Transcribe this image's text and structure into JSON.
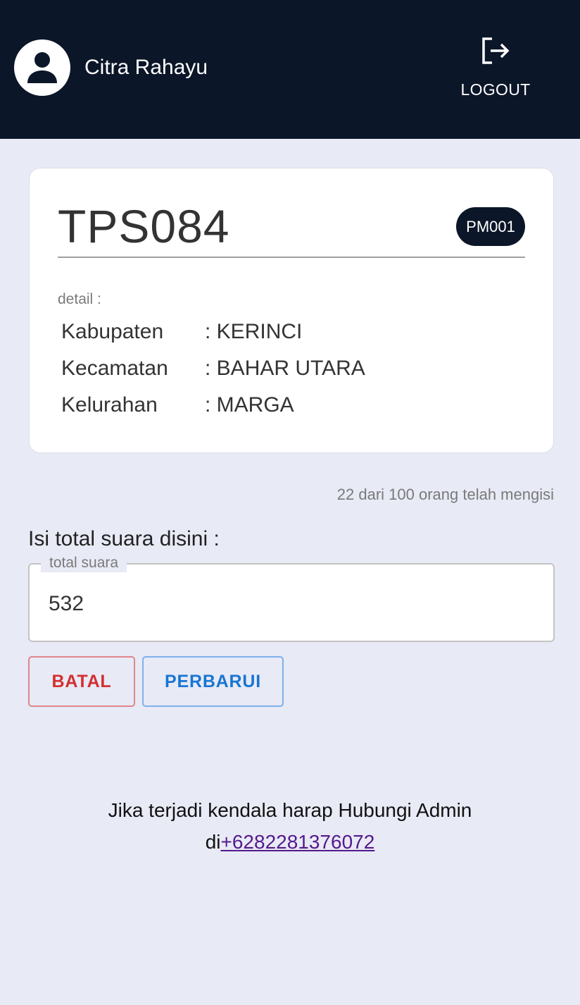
{
  "header": {
    "username": "Citra Rahayu",
    "avatar_icon": "person-icon",
    "logout_label": "LOGOUT",
    "logout_icon": "logout-icon",
    "background": "#0b1628"
  },
  "card": {
    "tps_code": "TPS084",
    "badge": "PM001",
    "detail_label": "detail :",
    "details": [
      {
        "key": "Kabupaten",
        "value": ": KERINCI"
      },
      {
        "key": "Kecamatan",
        "value": ": BAHAR UTARA"
      },
      {
        "key": "Kelurahan",
        "value": ": MARGA"
      }
    ]
  },
  "progress_text": "22 dari 100 orang telah mengisi",
  "form": {
    "heading": "Isi total suara disini :",
    "field_label": "total suara",
    "field_value": "532",
    "cancel_label": "BATAL",
    "update_label": "PERBARUI",
    "cancel_color": "#d32f2f",
    "update_color": "#1976d2"
  },
  "footer": {
    "line1": "Jika terjadi kendala harap Hubungi Admin",
    "prefix": "di",
    "phone": "+6282281376072"
  }
}
